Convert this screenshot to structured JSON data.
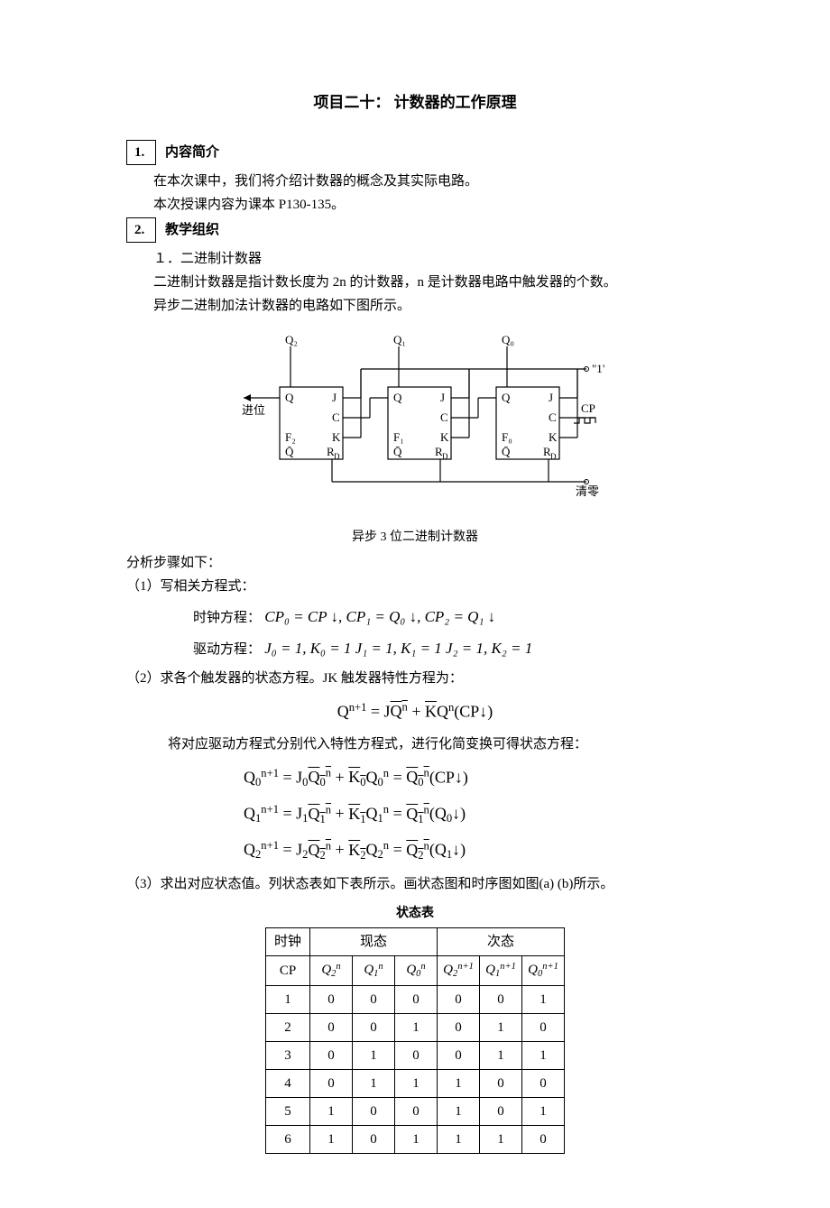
{
  "title": "项目二十：    计数器的工作原理",
  "sec1": {
    "num": "1.",
    "head": "内容简介",
    "p1": "在本次课中，我们将介绍计数器的概念及其实际电路。",
    "p2": "本次授课内容为课本 P130-135。"
  },
  "sec2": {
    "num": "2.",
    "head": "教学组织",
    "sub1": "１．二进制计数器",
    "p1": "二进制计数器是指计数长度为 2n 的计数器，n 是计数器电路中触发器的个数。",
    "p2": "异步二进制加法计数器的电路如下图所示。"
  },
  "fig": {
    "q2": "Q₂",
    "q1": "Q₁",
    "q0": "Q₀",
    "one": "\"1\"",
    "carry": "进位",
    "cp": "CP",
    "clear": "清零",
    "f2": "F₂",
    "f1": "F₁",
    "f0": "F₀",
    "j": "J",
    "k": "K",
    "c": "C",
    "q": "Q",
    "qb": "Q̄",
    "rd": "R_D",
    "caption": "异步 3 位二进制计数器"
  },
  "analysis": {
    "intro": "分析步骤如下：",
    "s1": "（1）写相关方程式：",
    "clk_label": "时钟方程：",
    "clk_eq": "CP₀ = CP ↓, CP₁ = Q₀ ↓, CP₂ = Q₁ ↓",
    "drv_label": "驱动方程：",
    "drv_eq": "J₀ = 1, K₀ = 1      J₁ = 1, K₁ = 1      J₂ = 1, K₂ = 1",
    "s2": "（2）求各个触发器的状态方程。JK 触发器特性方程为：",
    "char_eq_html": "Q<sup>n+1</sup> = J<span class='ov'>Q<sup>n</sup></span> + <span class='ov'>K</span>Q<sup>n</sup>(CP↓)",
    "s2b": "将对应驱动方程式分别代入特性方程式，进行化简变换可得状态方程：",
    "eq0_html": "Q<sub>0</sub><sup>n+1</sup> = J<sub>0</sub><span class='ov'>Q<sub>0</sub><sup>n</sup></span> + <span class='ov'>K<sub>0</sub></span>Q<sub>0</sub><sup>n</sup> = <span class='ov'>Q<sub>0</sub><sup>n</sup></span>(CP↓)",
    "eq1_html": "Q<sub>1</sub><sup>n+1</sup> = J<sub>1</sub><span class='ov'>Q<sub>1</sub><sup>n</sup></span> + <span class='ov'>K<sub>1</sub></span>Q<sub>1</sub><sup>n</sup> = <span class='ov'>Q<sub>1</sub><sup>n</sup></span>(Q<sub>0</sub>↓)",
    "eq2_html": "Q<sub>2</sub><sup>n+1</sup> = J<sub>2</sub><span class='ov'>Q<sub>2</sub><sup>n</sup></span> + <span class='ov'>K<sub>2</sub></span>Q<sub>2</sub><sup>n</sup> = <span class='ov'>Q<sub>2</sub><sup>n</sup></span>(Q<sub>1</sub>↓)",
    "s3": "（3）求出对应状态值。列状态表如下表所示。画状态图和时序图如图(a) (b)所示。"
  },
  "table": {
    "caption": "状态表",
    "h_clock": "时钟",
    "h_cur": "现态",
    "h_next": "次态",
    "h_cp": "CP",
    "h_q2n": "Q<sub>2</sub><sup>n</sup>",
    "h_q1n": "Q<sub>1</sub><sup>n</sup>",
    "h_q0n": "Q<sub>0</sub><sup>n</sup>",
    "h_q2n1": "Q<sub>2</sub><sup>n+1</sup>",
    "h_q1n1": "Q<sub>1</sub><sup>n+1</sup>",
    "h_q0n1": "Q<sub>0</sub><sup>n+1</sup>",
    "rows": [
      {
        "cp": "1",
        "q2": "0",
        "q1": "0",
        "q0": "0",
        "q2n": "0",
        "q1n": "0",
        "q0n": "1"
      },
      {
        "cp": "2",
        "q2": "0",
        "q1": "0",
        "q0": "1",
        "q2n": "0",
        "q1n": "1",
        "q0n": "0"
      },
      {
        "cp": "3",
        "q2": "0",
        "q1": "1",
        "q0": "0",
        "q2n": "0",
        "q1n": "1",
        "q0n": "1"
      },
      {
        "cp": "4",
        "q2": "0",
        "q1": "1",
        "q0": "1",
        "q2n": "1",
        "q1n": "0",
        "q0n": "0"
      },
      {
        "cp": "5",
        "q2": "1",
        "q1": "0",
        "q0": "0",
        "q2n": "1",
        "q1n": "0",
        "q0n": "1"
      },
      {
        "cp": "6",
        "q2": "1",
        "q1": "0",
        "q0": "1",
        "q2n": "1",
        "q1n": "1",
        "q0n": "0"
      }
    ]
  }
}
